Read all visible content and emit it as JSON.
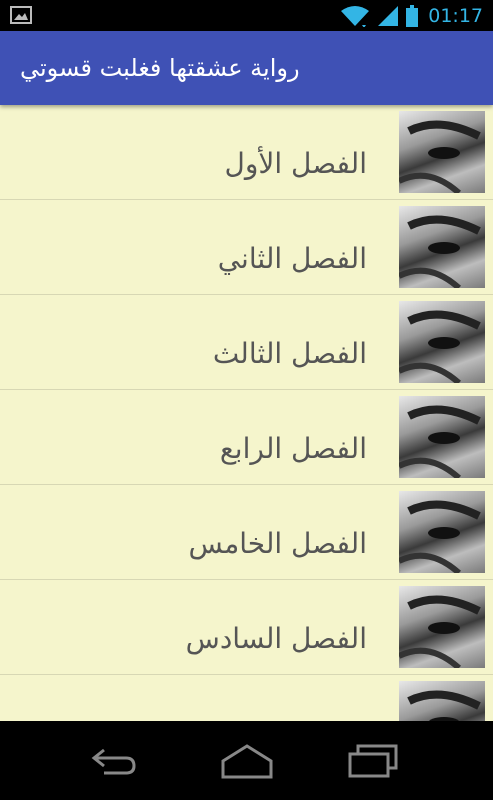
{
  "status_bar": {
    "time": "01:17",
    "icons": [
      "gallery-icon",
      "wifi-icon",
      "signal-icon",
      "battery-icon"
    ],
    "accent_color": "#33b5e5"
  },
  "action_bar": {
    "title": "رواية عشقتها فغلبت قسوتي",
    "color": "#3f51b5"
  },
  "chapters": [
    {
      "label": "الفصل الأول"
    },
    {
      "label": "الفصل الثاني"
    },
    {
      "label": "الفصل الثالث"
    },
    {
      "label": "الفصل الرابع"
    },
    {
      "label": "الفصل الخامس"
    },
    {
      "label": "الفصل السادس"
    },
    {
      "label": ""
    }
  ],
  "list_background": "#f5f5cc",
  "nav_bar": {
    "buttons": [
      "back-icon",
      "home-icon",
      "recent-apps-icon"
    ]
  }
}
